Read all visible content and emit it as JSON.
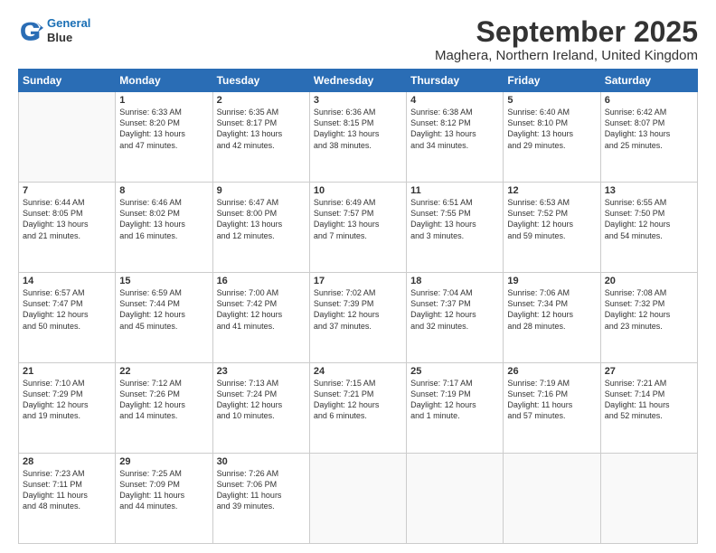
{
  "header": {
    "logo_line1": "General",
    "logo_line2": "Blue",
    "month_title": "September 2025",
    "location": "Maghera, Northern Ireland, United Kingdom"
  },
  "weekdays": [
    "Sunday",
    "Monday",
    "Tuesday",
    "Wednesday",
    "Thursday",
    "Friday",
    "Saturday"
  ],
  "weeks": [
    [
      {
        "day": "",
        "info": ""
      },
      {
        "day": "1",
        "info": "Sunrise: 6:33 AM\nSunset: 8:20 PM\nDaylight: 13 hours\nand 47 minutes."
      },
      {
        "day": "2",
        "info": "Sunrise: 6:35 AM\nSunset: 8:17 PM\nDaylight: 13 hours\nand 42 minutes."
      },
      {
        "day": "3",
        "info": "Sunrise: 6:36 AM\nSunset: 8:15 PM\nDaylight: 13 hours\nand 38 minutes."
      },
      {
        "day": "4",
        "info": "Sunrise: 6:38 AM\nSunset: 8:12 PM\nDaylight: 13 hours\nand 34 minutes."
      },
      {
        "day": "5",
        "info": "Sunrise: 6:40 AM\nSunset: 8:10 PM\nDaylight: 13 hours\nand 29 minutes."
      },
      {
        "day": "6",
        "info": "Sunrise: 6:42 AM\nSunset: 8:07 PM\nDaylight: 13 hours\nand 25 minutes."
      }
    ],
    [
      {
        "day": "7",
        "info": "Sunrise: 6:44 AM\nSunset: 8:05 PM\nDaylight: 13 hours\nand 21 minutes."
      },
      {
        "day": "8",
        "info": "Sunrise: 6:46 AM\nSunset: 8:02 PM\nDaylight: 13 hours\nand 16 minutes."
      },
      {
        "day": "9",
        "info": "Sunrise: 6:47 AM\nSunset: 8:00 PM\nDaylight: 13 hours\nand 12 minutes."
      },
      {
        "day": "10",
        "info": "Sunrise: 6:49 AM\nSunset: 7:57 PM\nDaylight: 13 hours\nand 7 minutes."
      },
      {
        "day": "11",
        "info": "Sunrise: 6:51 AM\nSunset: 7:55 PM\nDaylight: 13 hours\nand 3 minutes."
      },
      {
        "day": "12",
        "info": "Sunrise: 6:53 AM\nSunset: 7:52 PM\nDaylight: 12 hours\nand 59 minutes."
      },
      {
        "day": "13",
        "info": "Sunrise: 6:55 AM\nSunset: 7:50 PM\nDaylight: 12 hours\nand 54 minutes."
      }
    ],
    [
      {
        "day": "14",
        "info": "Sunrise: 6:57 AM\nSunset: 7:47 PM\nDaylight: 12 hours\nand 50 minutes."
      },
      {
        "day": "15",
        "info": "Sunrise: 6:59 AM\nSunset: 7:44 PM\nDaylight: 12 hours\nand 45 minutes."
      },
      {
        "day": "16",
        "info": "Sunrise: 7:00 AM\nSunset: 7:42 PM\nDaylight: 12 hours\nand 41 minutes."
      },
      {
        "day": "17",
        "info": "Sunrise: 7:02 AM\nSunset: 7:39 PM\nDaylight: 12 hours\nand 37 minutes."
      },
      {
        "day": "18",
        "info": "Sunrise: 7:04 AM\nSunset: 7:37 PM\nDaylight: 12 hours\nand 32 minutes."
      },
      {
        "day": "19",
        "info": "Sunrise: 7:06 AM\nSunset: 7:34 PM\nDaylight: 12 hours\nand 28 minutes."
      },
      {
        "day": "20",
        "info": "Sunrise: 7:08 AM\nSunset: 7:32 PM\nDaylight: 12 hours\nand 23 minutes."
      }
    ],
    [
      {
        "day": "21",
        "info": "Sunrise: 7:10 AM\nSunset: 7:29 PM\nDaylight: 12 hours\nand 19 minutes."
      },
      {
        "day": "22",
        "info": "Sunrise: 7:12 AM\nSunset: 7:26 PM\nDaylight: 12 hours\nand 14 minutes."
      },
      {
        "day": "23",
        "info": "Sunrise: 7:13 AM\nSunset: 7:24 PM\nDaylight: 12 hours\nand 10 minutes."
      },
      {
        "day": "24",
        "info": "Sunrise: 7:15 AM\nSunset: 7:21 PM\nDaylight: 12 hours\nand 6 minutes."
      },
      {
        "day": "25",
        "info": "Sunrise: 7:17 AM\nSunset: 7:19 PM\nDaylight: 12 hours\nand 1 minute."
      },
      {
        "day": "26",
        "info": "Sunrise: 7:19 AM\nSunset: 7:16 PM\nDaylight: 11 hours\nand 57 minutes."
      },
      {
        "day": "27",
        "info": "Sunrise: 7:21 AM\nSunset: 7:14 PM\nDaylight: 11 hours\nand 52 minutes."
      }
    ],
    [
      {
        "day": "28",
        "info": "Sunrise: 7:23 AM\nSunset: 7:11 PM\nDaylight: 11 hours\nand 48 minutes."
      },
      {
        "day": "29",
        "info": "Sunrise: 7:25 AM\nSunset: 7:09 PM\nDaylight: 11 hours\nand 44 minutes."
      },
      {
        "day": "30",
        "info": "Sunrise: 7:26 AM\nSunset: 7:06 PM\nDaylight: 11 hours\nand 39 minutes."
      },
      {
        "day": "",
        "info": ""
      },
      {
        "day": "",
        "info": ""
      },
      {
        "day": "",
        "info": ""
      },
      {
        "day": "",
        "info": ""
      }
    ]
  ]
}
